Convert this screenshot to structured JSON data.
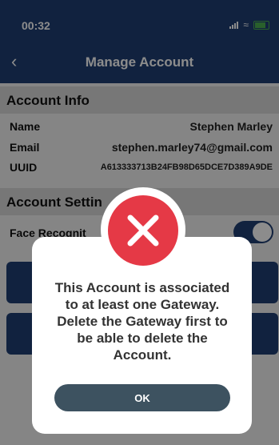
{
  "status_bar": {
    "time": "00:32"
  },
  "nav": {
    "back_icon": "chevron-left-icon",
    "title": "Manage Account"
  },
  "account_info": {
    "header": "Account Info",
    "rows": [
      {
        "label": "Name",
        "value": "Stephen Marley"
      },
      {
        "label": "Email",
        "value": "stephen.marley74@gmail.com"
      },
      {
        "label": "UUID",
        "value": "A613333713B24FB98D65DCE7D389A9DE"
      }
    ]
  },
  "account_settings": {
    "header": "Account Settin",
    "face_label": "Face Recognit",
    "face_enabled": true
  },
  "dialog": {
    "icon": "error-x-icon",
    "message_lines": [
      "This Account is associated",
      "to at least one Gateway.",
      "Delete the Gateway first to",
      "be able to delete the",
      "Account."
    ],
    "ok_label": "OK"
  },
  "colors": {
    "primary": "#1f3f73",
    "error": "#e53946",
    "ok_button": "#3d5260"
  }
}
